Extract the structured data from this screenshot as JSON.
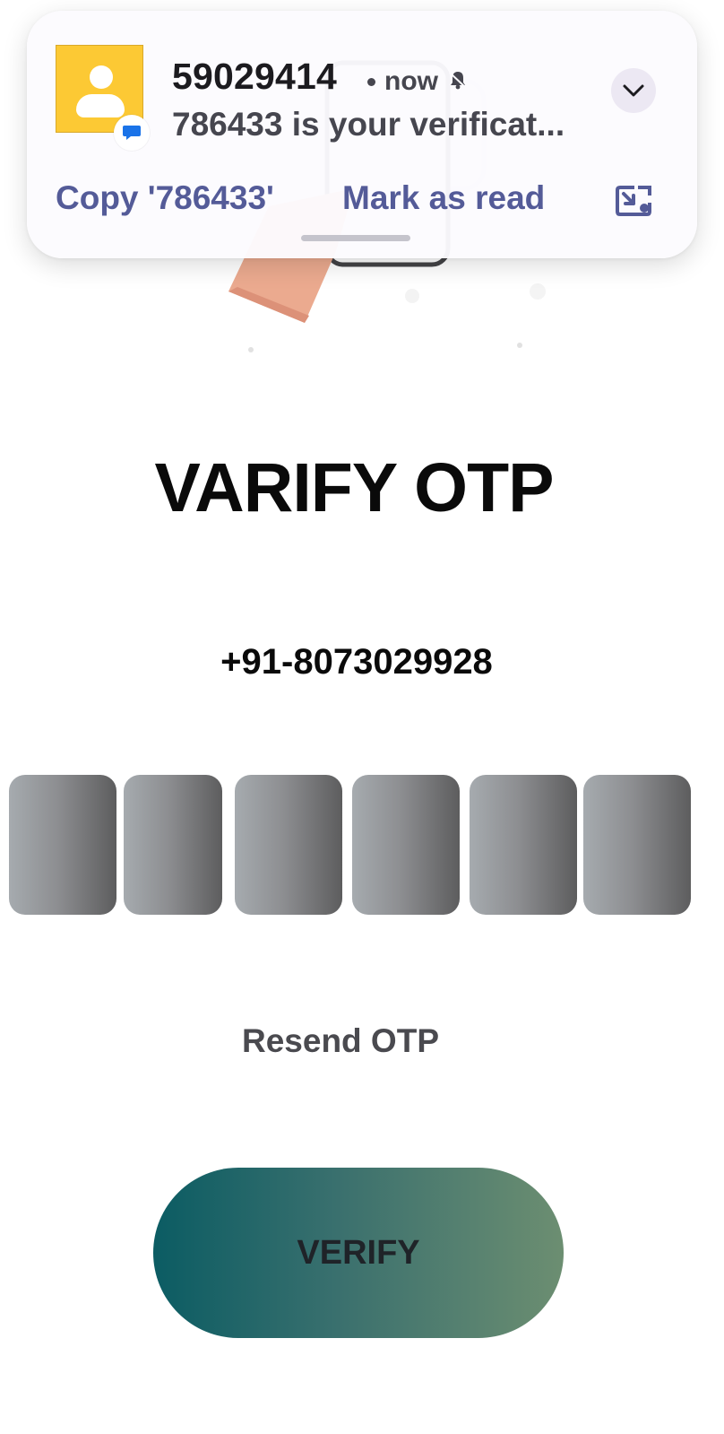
{
  "notification": {
    "sender": "59029414",
    "time": "now",
    "message": "786433 is your verificat...",
    "actions": {
      "copy": "Copy '786433'",
      "mark_read": "Mark as read"
    },
    "icons": {
      "avatar": "person-icon",
      "app_badge": "message-bubble-icon",
      "bell": "bell-icon",
      "expand": "chevron-down-icon",
      "popout": "popout-window-icon"
    },
    "colors": {
      "avatar_bg": "#fcc934",
      "action_text": "#545b98",
      "badge": "#1a73e8"
    }
  },
  "page": {
    "title": "VARIFY OTP",
    "phone": "+91-8073029928",
    "otp_digit_count": 6,
    "resend_label": "Resend OTP",
    "verify_label": "VERIFY"
  }
}
